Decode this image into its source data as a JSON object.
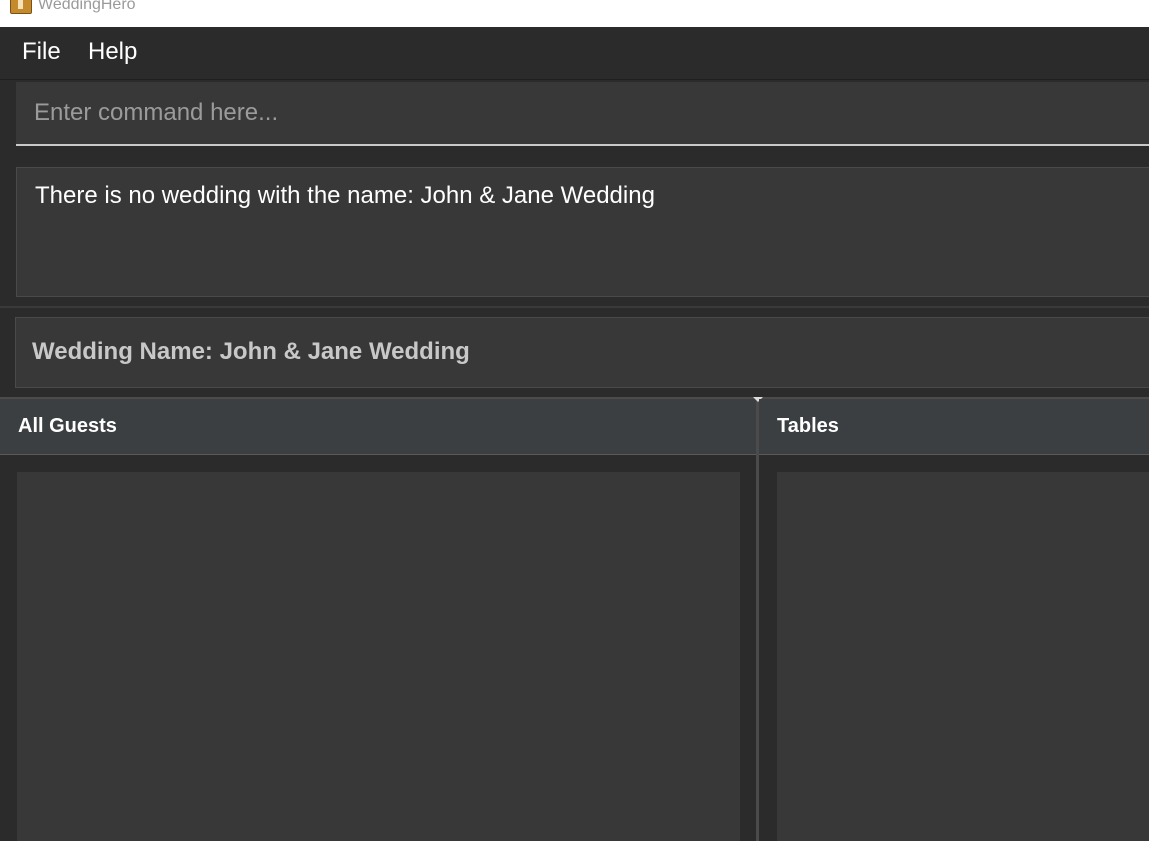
{
  "window": {
    "title": "WeddingHero"
  },
  "menu": {
    "file_label": "File",
    "help_label": "Help"
  },
  "command": {
    "placeholder": "Enter command here...",
    "value": ""
  },
  "result": {
    "message": "There is no wedding with the name: John & Jane Wedding"
  },
  "wedding": {
    "name_text": "Wedding Name: John & Jane Wedding"
  },
  "panels": {
    "guests_title": "All Guests",
    "tables_title": "Tables"
  },
  "colors": {
    "background": "#2b2b2b",
    "panel": "#383838",
    "header": "#3b3f42",
    "text": "#ffffff"
  }
}
